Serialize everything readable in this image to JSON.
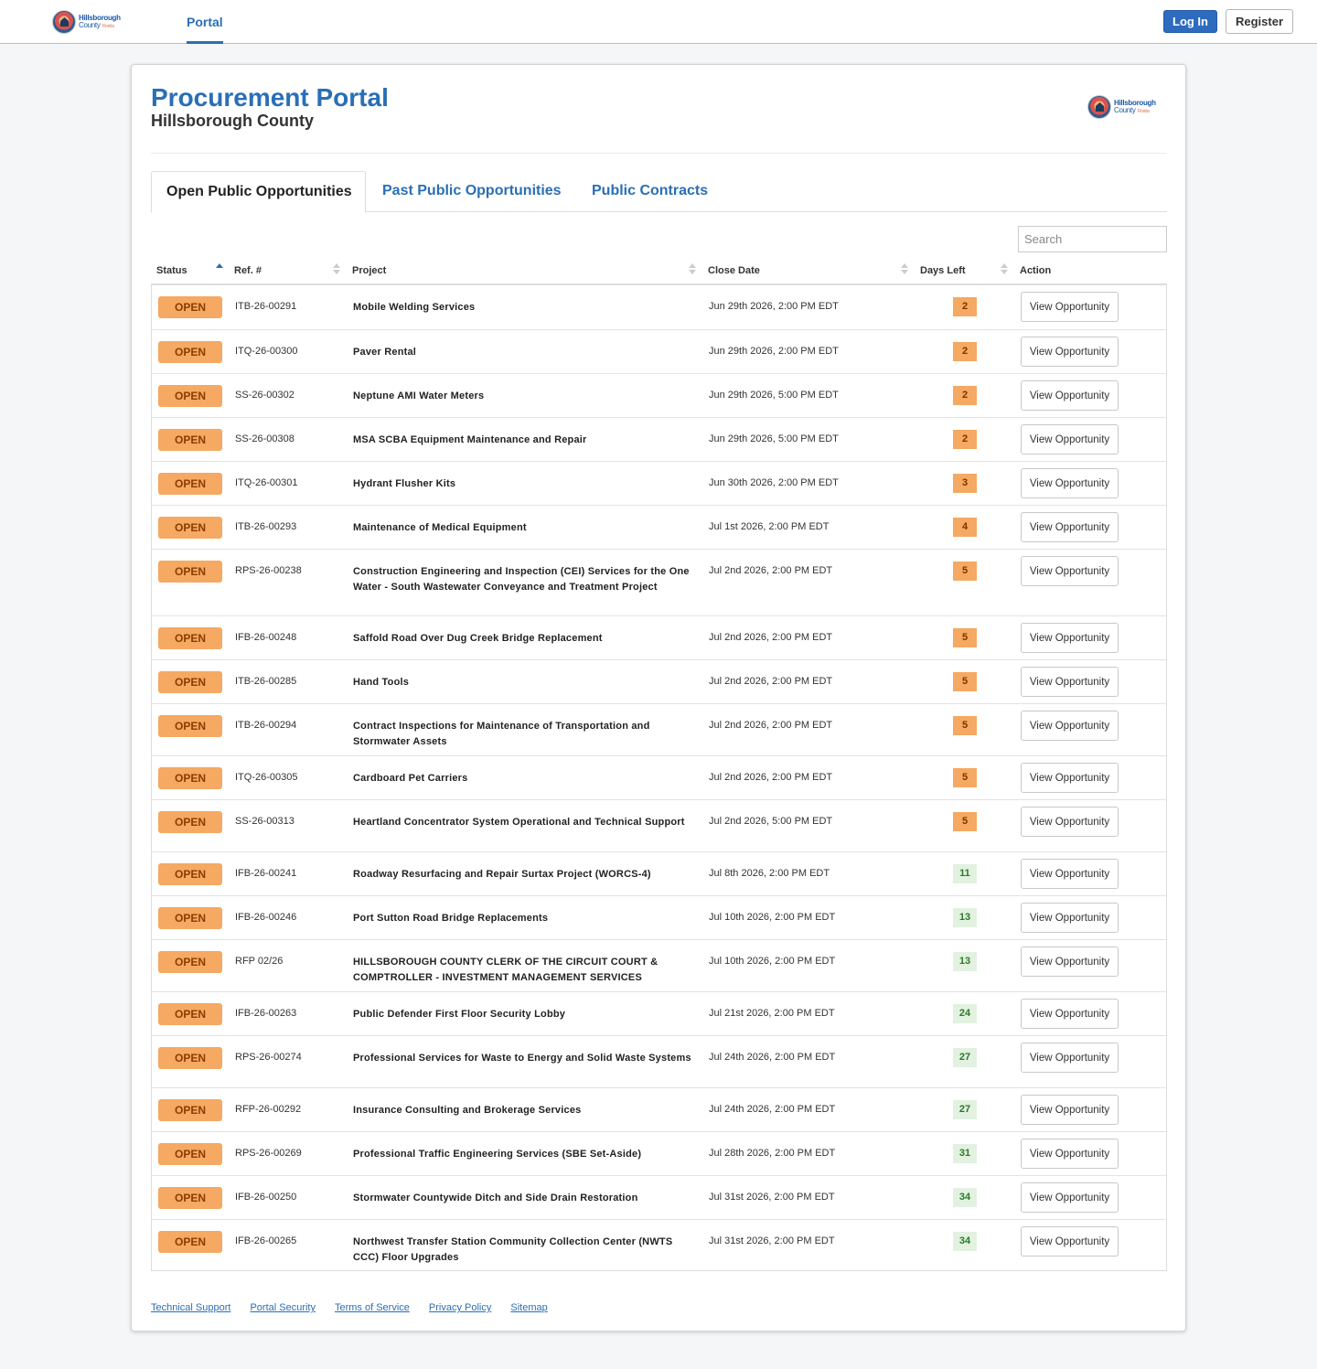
{
  "brand": {
    "logo_line1": "Hillsborough",
    "logo_line2": "County",
    "logo_line3": "Florida"
  },
  "nav": {
    "portal": "Portal",
    "login": "Log In",
    "register": "Register"
  },
  "header": {
    "title": "Procurement Portal",
    "subtitle": "Hillsborough County"
  },
  "tabs": [
    "Open Public Opportunities",
    "Past Public Opportunities",
    "Public Contracts"
  ],
  "search": {
    "placeholder": "Search"
  },
  "table": {
    "columns": [
      "Status",
      "Ref. #",
      "Project",
      "Close Date",
      "Days Left",
      "Action"
    ],
    "rows": [
      {
        "status": "OPEN",
        "ref": "ITB-26-00291",
        "project": "Mobile Welding Services",
        "close": "Jun 29th 2026, 2:00 PM EDT",
        "days": "2",
        "action": "View Opportunity"
      },
      {
        "status": "OPEN",
        "ref": "ITQ-26-00300",
        "project": "Paver Rental",
        "close": "Jun 29th 2026, 2:00 PM EDT",
        "days": "2",
        "action": "View Opportunity"
      },
      {
        "status": "OPEN",
        "ref": "SS-26-00302",
        "project": "Neptune AMI Water Meters",
        "close": "Jun 29th 2026, 5:00 PM EDT",
        "days": "2",
        "action": "View Opportunity"
      },
      {
        "status": "OPEN",
        "ref": "SS-26-00308",
        "project": "MSA SCBA Equipment Maintenance and Repair",
        "close": "Jun 29th 2026, 5:00 PM EDT",
        "days": "2",
        "action": "View Opportunity"
      },
      {
        "status": "OPEN",
        "ref": "ITQ-26-00301",
        "project": "Hydrant Flusher Kits",
        "close": "Jun 30th 2026, 2:00 PM EDT",
        "days": "3",
        "action": "View Opportunity"
      },
      {
        "status": "OPEN",
        "ref": "ITB-26-00293",
        "project": "Maintenance of Medical Equipment",
        "close": "Jul 1st 2026, 2:00 PM EDT",
        "days": "4",
        "action": "View Opportunity"
      },
      {
        "status": "OPEN",
        "ref": "RPS-26-00238",
        "project": "Construction Engineering and Inspection (CEI) Services for the One Water - South Wastewater Conveyance and Treatment Project",
        "close": "Jul 2nd 2026, 2:00 PM EDT",
        "days": "5",
        "action": "View Opportunity"
      },
      {
        "status": "OPEN",
        "ref": "IFB-26-00248",
        "project": "Saffold Road Over Dug Creek Bridge Replacement",
        "close": "Jul 2nd 2026, 2:00 PM EDT",
        "days": "5",
        "action": "View Opportunity"
      },
      {
        "status": "OPEN",
        "ref": "ITB-26-00285",
        "project": "Hand Tools",
        "close": "Jul 2nd 2026, 2:00 PM EDT",
        "days": "5",
        "action": "View Opportunity"
      },
      {
        "status": "OPEN",
        "ref": "ITB-26-00294",
        "project": "Contract Inspections for Maintenance of Transportation and Stormwater Assets",
        "close": "Jul 2nd 2026, 2:00 PM EDT",
        "days": "5",
        "action": "View Opportunity"
      },
      {
        "status": "OPEN",
        "ref": "ITQ-26-00305",
        "project": "Cardboard Pet Carriers",
        "close": "Jul 2nd 2026, 2:00 PM EDT",
        "days": "5",
        "action": "View Opportunity"
      },
      {
        "status": "OPEN",
        "ref": "SS-26-00313",
        "project": "Heartland Concentrator System Operational and Technical Support",
        "close": "Jul 2nd 2026, 5:00 PM EDT",
        "days": "5",
        "action": "View Opportunity"
      },
      {
        "status": "OPEN",
        "ref": "IFB-26-00241",
        "project": "Roadway Resurfacing and Repair Surtax Project (WORCS-4)",
        "close": "Jul 8th 2026, 2:00 PM EDT",
        "days": "11",
        "action": "View Opportunity"
      },
      {
        "status": "OPEN",
        "ref": "IFB-26-00246",
        "project": "Port Sutton Road Bridge Replacements",
        "close": "Jul 10th 2026, 2:00 PM EDT",
        "days": "13",
        "action": "View Opportunity"
      },
      {
        "status": "OPEN",
        "ref": "RFP 02/26",
        "project": "HILLSBOROUGH COUNTY CLERK OF THE CIRCUIT COURT & COMPTROLLER - INVESTMENT MANAGEMENT SERVICES",
        "close": "Jul 10th 2026, 2:00 PM EDT",
        "days": "13",
        "action": "View Opportunity"
      },
      {
        "status": "OPEN",
        "ref": "IFB-26-00263",
        "project": "Public Defender First Floor Security Lobby",
        "close": "Jul 21st 2026, 2:00 PM EDT",
        "days": "24",
        "action": "View Opportunity"
      },
      {
        "status": "OPEN",
        "ref": "RPS-26-00274",
        "project": "Professional Services for Waste to Energy and Solid Waste Systems",
        "close": "Jul 24th 2026, 2:00 PM EDT",
        "days": "27",
        "action": "View Opportunity"
      },
      {
        "status": "OPEN",
        "ref": "RFP-26-00292",
        "project": "Insurance Consulting and Brokerage Services",
        "close": "Jul 24th 2026, 2:00 PM EDT",
        "days": "27",
        "action": "View Opportunity"
      },
      {
        "status": "OPEN",
        "ref": "RPS-26-00269",
        "project": "Professional Traffic Engineering Services (SBE Set-Aside)",
        "close": "Jul 28th 2026, 2:00 PM EDT",
        "days": "31",
        "action": "View Opportunity"
      },
      {
        "status": "OPEN",
        "ref": "IFB-26-00250",
        "project": "Stormwater Countywide Ditch and Side Drain Restoration",
        "close": "Jul 31st 2026, 2:00 PM EDT",
        "days": "34",
        "action": "View Opportunity"
      },
      {
        "status": "OPEN",
        "ref": "IFB-26-00265",
        "project": "Northwest Transfer Station Community Collection Center (NWTS CCC) Floor Upgrades",
        "close": "Jul 31st 2026, 2:00 PM EDT",
        "days": "34",
        "action": "View Opportunity"
      }
    ]
  },
  "footer": [
    "Technical Support",
    "Portal Security",
    "Terms of Service",
    "Privacy Policy",
    "Sitemap"
  ],
  "colors": {
    "brand_blue": "#2a6fb5",
    "open_badge": "#f5a962",
    "days_soon": "#f5a962",
    "days_later": "#e2f1e0"
  }
}
